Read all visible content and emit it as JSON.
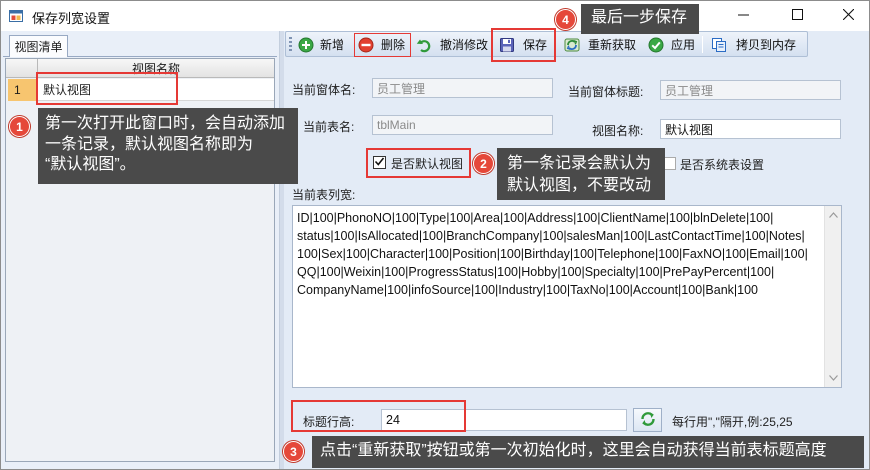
{
  "window": {
    "title": "保存列宽设置",
    "app_icon": "app-window-icon",
    "minimize_icon": "minimize-icon",
    "maximize_icon": "maximize-icon",
    "close_icon": "close-icon"
  },
  "left_panel": {
    "tab_label": "视图清单",
    "grid": {
      "column_header": "视图名称",
      "rows": [
        {
          "index": "1",
          "view_name": "默认视图"
        }
      ]
    }
  },
  "toolbar": {
    "add": {
      "label": "新增",
      "icon": "add-circle-icon"
    },
    "delete": {
      "label": "删除",
      "icon": "remove-circle-icon"
    },
    "undo": {
      "label": "撤消修改",
      "icon": "undo-icon"
    },
    "save": {
      "label": "保存",
      "icon": "floppy-disk-icon"
    },
    "refresh": {
      "label": "重新获取",
      "icon": "refresh-icon"
    },
    "apply": {
      "label": "应用",
      "icon": "check-circle-icon"
    },
    "copy": {
      "label": "拷贝到内存",
      "icon": "copy-icon"
    }
  },
  "form": {
    "form_name_label": "当前窗体名:",
    "form_name_value": "员工管理",
    "form_title_label": "当前窗体标题:",
    "form_title_value": "员工管理",
    "table_name_label": "当前表名:",
    "table_name_value": "tblMain",
    "view_name_label": "视图名称:",
    "view_name_value": "默认视图",
    "is_default_view_label": "是否默认视图",
    "is_default_view_checked": true,
    "is_system_table_label": "是否系统表设置",
    "is_system_table_checked": false,
    "column_widths_label": "当前表列宽:",
    "column_widths_lines": [
      "ID|100|PhonoNO|100|Type|100|Area|100|Address|100|ClientName|100|blnDelete|100|",
      "status|100|IsAllocated|100|BranchCompany|100|salesMan|100|LastContactTime|100|Notes|",
      "100|Sex|100|Character|100|Position|100|Birthday|100|Telephone|100|FaxNO|100|Email|100|",
      "QQ|100|Weixin|100|ProgressStatus|100|Hobby|100|Specialty|100|PrePayPercent|100|",
      "CompanyName|100|infoSource|100|Industry|100|TaxNo|100|Account|100|Bank|100"
    ],
    "header_height_label": "标题行高:",
    "header_height_value": "24",
    "header_height_hint": "每行用\",\"隔开,例:25,25"
  },
  "annotations": [
    {
      "number": "1",
      "lines": [
        "第一次打开此窗口时，会自动添加",
        "一条记录，默认视图名称即为",
        "“默认视图”。"
      ]
    },
    {
      "number": "2",
      "lines": [
        "第一条记录会默认为",
        "默认视图，不要改动"
      ]
    },
    {
      "number": "3",
      "lines": [
        "点击“重新获取”按钮或第一次初始化时，这里会自动获得当前表标题高度"
      ]
    },
    {
      "number": "4",
      "lines": [
        "最后一步保存"
      ]
    }
  ],
  "colors": {
    "annotation_bg": "#4a4a4a",
    "annotation_badge": "#e5483a",
    "highlight_box": "#e53935",
    "row_index_bg": "#f7c56f"
  }
}
